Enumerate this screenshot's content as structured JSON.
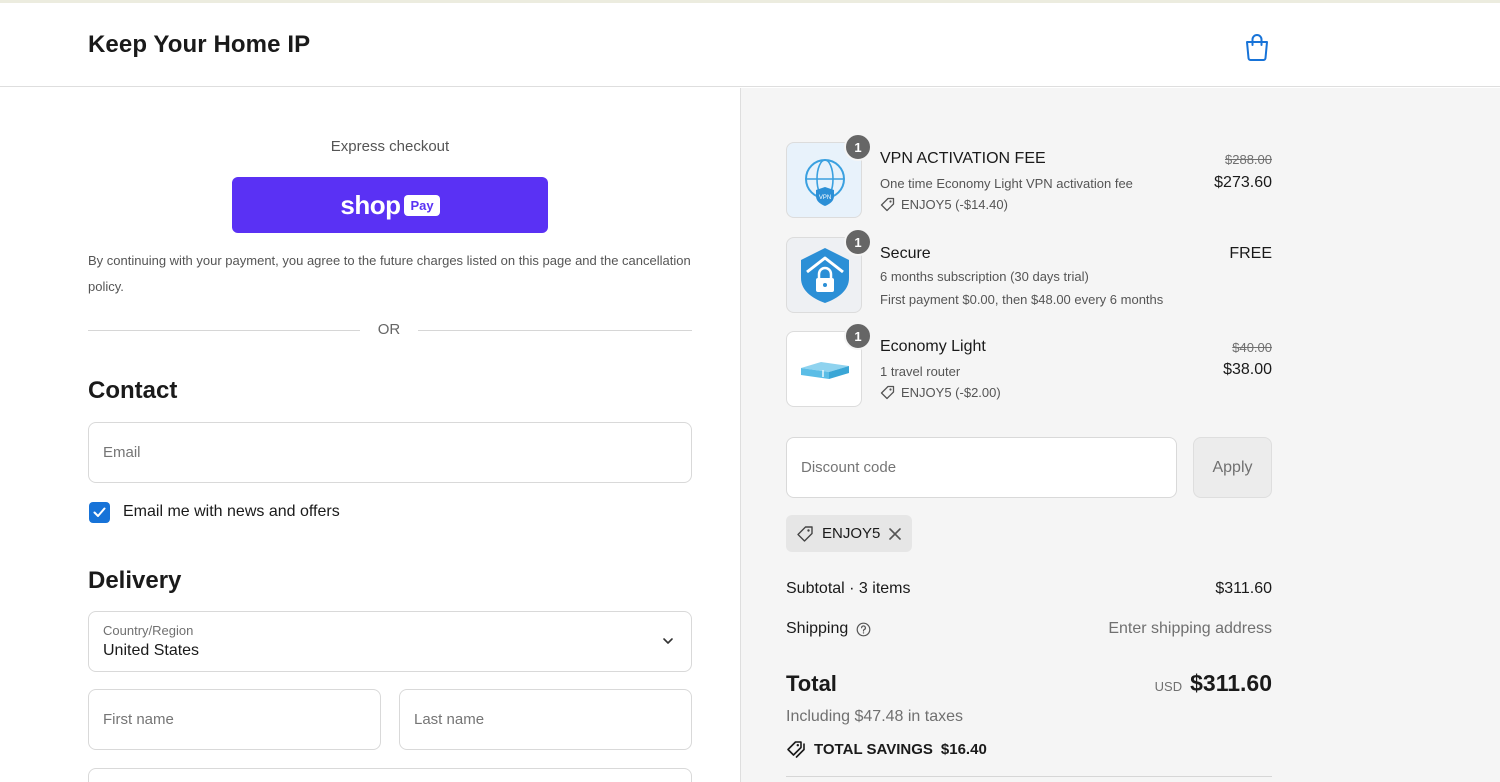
{
  "header": {
    "store_name": "Keep Your Home IP",
    "cart_icon": "shopping-bag-icon"
  },
  "express": {
    "label": "Express checkout",
    "shoppay_brand": "shop",
    "shoppay_badge": "Pay",
    "shoppay_color": "#5a31f4",
    "legal_text": "By continuing with your payment, you agree to the future charges listed on this page and the cancellation policy.",
    "or_text": "OR"
  },
  "contact": {
    "heading": "Contact",
    "email_placeholder": "Email",
    "newsletter_label": "Email me with news and offers",
    "newsletter_checked": true
  },
  "delivery": {
    "heading": "Delivery",
    "country_label": "Country/Region",
    "country_value": "United States",
    "first_name_placeholder": "First name",
    "last_name_placeholder": "Last name"
  },
  "order": {
    "items": [
      {
        "qty": "1",
        "name": "VPN ACTIVATION FEE",
        "subtitle": "One time Economy Light VPN activation fee",
        "discount": "ENJOY5 (-$14.40)",
        "price_old": "$288.00",
        "price": "$273.60",
        "icon": "vpn-globe-shield-icon"
      },
      {
        "qty": "1",
        "name": "Secure",
        "subtitle": "6 months subscription (30 days trial)",
        "subtitle2": "First payment $0.00, then $48.00 every 6 months",
        "price": "FREE",
        "icon": "home-shield-lock-icon"
      },
      {
        "qty": "1",
        "name": "Economy Light",
        "subtitle": "1 travel router",
        "discount": "ENJOY5 (-$2.00)",
        "price_old": "$40.00",
        "price": "$38.00",
        "icon": "travel-router-icon"
      }
    ],
    "discount_placeholder": "Discount code",
    "apply_label": "Apply",
    "applied_code": "ENJOY5",
    "subtotal_label": "Subtotal · 3 items",
    "subtotal_value": "$311.60",
    "shipping_label": "Shipping",
    "shipping_value": "Enter shipping address",
    "total_label": "Total",
    "total_currency": "USD",
    "total_value": "$311.60",
    "tax_note": "Including $47.48 in taxes",
    "savings_label": "TOTAL SAVINGS",
    "savings_value": "$16.40"
  },
  "colors": {
    "accent_blue": "#1773d8",
    "panel_bg": "#f5f5f5"
  }
}
